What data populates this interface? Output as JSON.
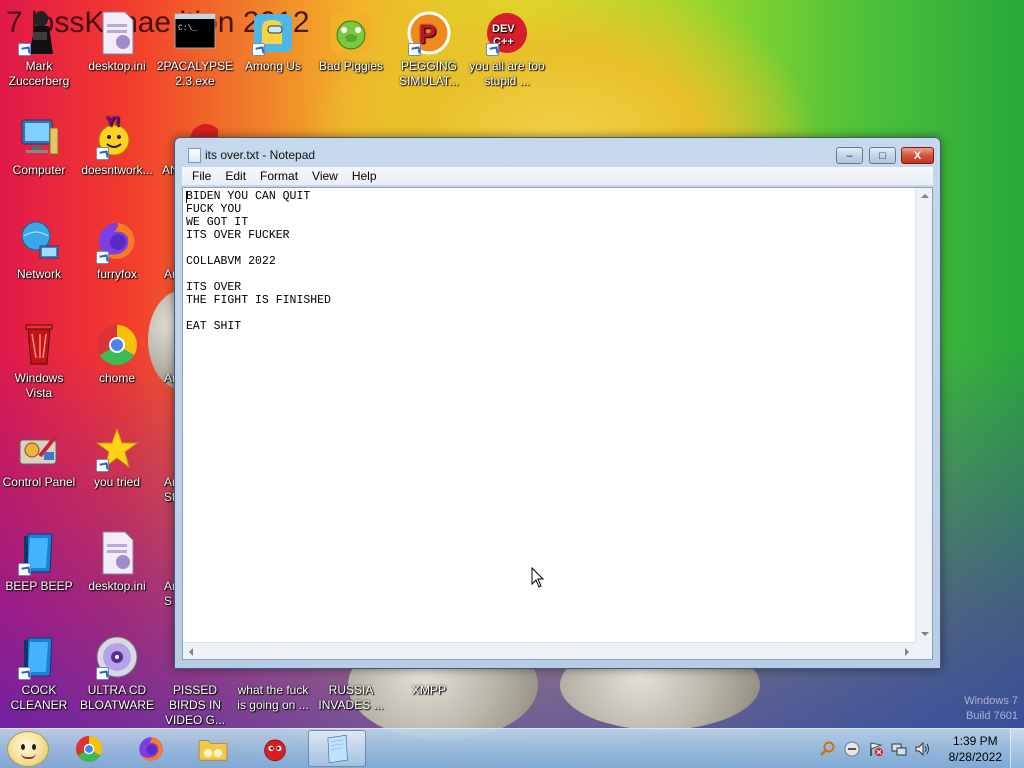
{
  "wallpaper": {
    "text": "7 lossKanae ition 2012",
    "watermark": [
      "Windows 7",
      "Build 7601"
    ]
  },
  "desktop_icons": [
    {
      "name": "mark-zuccerberg",
      "label": "Mark Zuccerberg",
      "icon": "figure-icon"
    },
    {
      "name": "desktop-ini-1",
      "label": "desktop.ini",
      "icon": "settings-file-icon"
    },
    {
      "name": "2pacalypse",
      "label": "2PACALYPSE 2.3.exe",
      "icon": "console-icon"
    },
    {
      "name": "among-us",
      "label": "Among Us",
      "icon": "among-us-icon"
    },
    {
      "name": "bad-piggies",
      "label": "Bad Piggies",
      "icon": "pig-icon"
    },
    {
      "name": "pegging-simulator",
      "label": "PEGGING SIMULAT...",
      "icon": "p-icon"
    },
    {
      "name": "you-all-are-too-stupid",
      "label": "you all are too stupid ...",
      "icon": "devcpp-icon"
    },
    {
      "name": "computer",
      "label": "Computer",
      "icon": "computer-icon"
    },
    {
      "name": "doesntwork",
      "label": "doesntwork...",
      "icon": "yahoo-icon"
    },
    {
      "name": "an-partial-1",
      "label": "AN",
      "icon": "angry-bird-icon"
    },
    {
      "name": "network",
      "label": "Network",
      "icon": "network-icon"
    },
    {
      "name": "furryfox",
      "label": "furryfox",
      "icon": "firefox-icon"
    },
    {
      "name": "an-partial-2",
      "label": "An",
      "icon": "app-icon"
    },
    {
      "name": "windows-vista",
      "label": "Windows Vista",
      "icon": "recycle-bin-icon"
    },
    {
      "name": "chome",
      "label": "chome",
      "icon": "chrome-icon"
    },
    {
      "name": "an-partial-3",
      "label": "An",
      "icon": "app-icon"
    },
    {
      "name": "control-panel",
      "label": "Control Panel",
      "icon": "control-panel-icon"
    },
    {
      "name": "you-tried",
      "label": "you tried",
      "icon": "star-icon"
    },
    {
      "name": "an-partial-4",
      "label": "An St",
      "icon": "app-icon"
    },
    {
      "name": "beep-beep",
      "label": "BEEP BEEP",
      "icon": "blue-book-icon"
    },
    {
      "name": "desktop-ini-2",
      "label": "desktop.ini",
      "icon": "settings-file-icon"
    },
    {
      "name": "an-partial-5",
      "label": "An S",
      "icon": "app-icon"
    },
    {
      "name": "cock-cleaner",
      "label": "COCK CLEANER",
      "icon": "blue-book-icon"
    },
    {
      "name": "ultra-cd-bloatware",
      "label": "ULTRA CD BLOATWARE",
      "icon": "cd-icon"
    },
    {
      "name": "pissed-birds",
      "label": "PISSED BIRDS IN VIDEO G...",
      "icon": "bird-icon"
    },
    {
      "name": "what-the-fuck",
      "label": "what the fuck is going on ...",
      "icon": "app-icon"
    },
    {
      "name": "russia-invades",
      "label": "RUSSIA INVADES ...",
      "icon": "app-icon"
    },
    {
      "name": "xmpp",
      "label": "XMPP",
      "icon": "app-icon"
    }
  ],
  "notepad": {
    "title": "its over.txt - Notepad",
    "buttons": {
      "minimize": "–",
      "maximize": "□",
      "close": "X"
    },
    "menu": [
      "File",
      "Edit",
      "Format",
      "View",
      "Help"
    ],
    "content": "BIDEN YOU CAN QUIT\nFUCK YOU\nWE GOT IT\nITS OVER FUCKER\n\nCOLLABVM 2022\n\nITS OVER\nTHE FIGHT IS FINISHED\n\nEAT SHIT"
  },
  "taskbar": {
    "pinned": [
      {
        "name": "chrome",
        "icon": "chrome-icon"
      },
      {
        "name": "firefox",
        "icon": "firefox-icon"
      },
      {
        "name": "explorer",
        "icon": "folder-icon"
      },
      {
        "name": "angry-red",
        "icon": "red-bird-icon"
      },
      {
        "name": "notepad",
        "icon": "notepad-icon",
        "active": true
      }
    ],
    "clock": {
      "time": "1:39 PM",
      "date": "8/28/2022"
    }
  },
  "colors": {
    "close_button": "#c1341c",
    "window_frame": "#b7cce5"
  }
}
